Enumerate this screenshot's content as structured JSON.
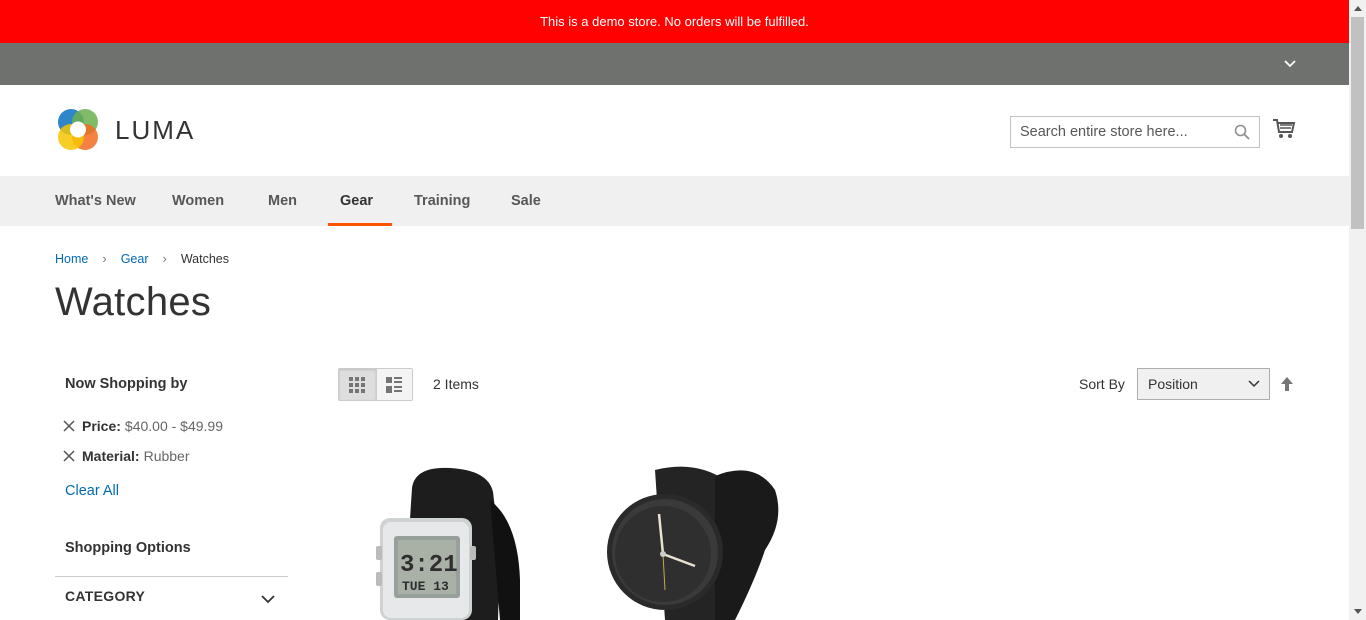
{
  "banner": {
    "text": "This is a demo store. No orders will be fulfilled."
  },
  "header": {
    "logo_text": "LUMA",
    "search_placeholder": "Search entire store here..."
  },
  "nav": {
    "items": [
      {
        "label": "What's New"
      },
      {
        "label": "Women"
      },
      {
        "label": "Men"
      },
      {
        "label": "Gear",
        "active": true
      },
      {
        "label": "Training"
      },
      {
        "label": "Sale"
      }
    ],
    "accent_color": "#ff5501"
  },
  "breadcrumb": {
    "home": "Home",
    "parent": "Gear",
    "current": "Watches",
    "separator": "›"
  },
  "page": {
    "title": "Watches"
  },
  "filters": {
    "title": "Now Shopping by",
    "active": [
      {
        "label": "Price:",
        "value": "$40.00 - $49.99"
      },
      {
        "label": "Material:",
        "value": "Rubber"
      }
    ],
    "clear_all": "Clear All",
    "shopping_options": "Shopping Options",
    "category": "CATEGORY"
  },
  "toolbar": {
    "amount": "2 Items",
    "sort_label": "Sort By",
    "sort_value": "Position"
  },
  "products": [
    {
      "name": "digital-watch",
      "display_time": "3:21",
      "display_day": "TUE 13"
    },
    {
      "name": "analog-watch"
    }
  ],
  "colors": {
    "banner": "#ff0101",
    "top_panel": "#6e716e",
    "link": "#006bb4"
  }
}
